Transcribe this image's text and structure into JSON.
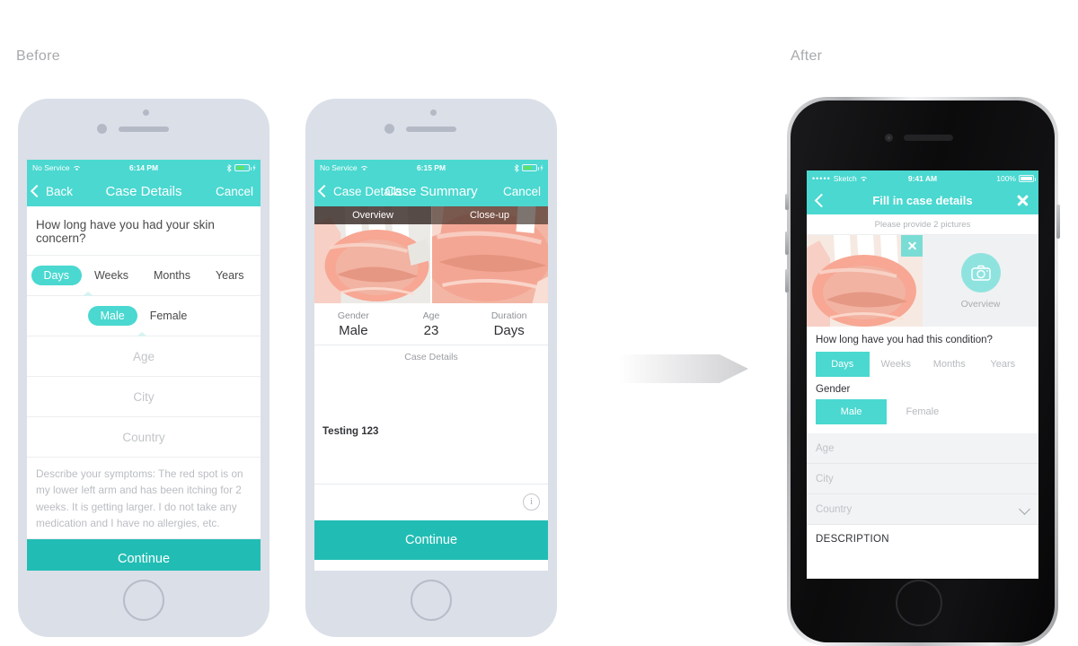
{
  "captions": {
    "before": "Before",
    "after": "After"
  },
  "arrow": {
    "name": "transition-arrow",
    "direction": "right",
    "color": "#d3d4d6"
  },
  "colors": {
    "teal_bar": "#4ad8d0",
    "teal_button": "#21bdb4",
    "teal_light": "#8fe3df",
    "phone_body_light": "#dbdfe8",
    "caption_gray": "#a7a9ac"
  },
  "phone1": {
    "status_bar": {
      "carrier": "No Service",
      "wifi_icon": "wifi-icon",
      "time": "6:14 PM",
      "bluetooth_icon": "bluetooth-icon",
      "battery_icon": "battery-icon",
      "charging_icon": "charging-bolt-icon"
    },
    "nav": {
      "back_icon": "chevron-left-icon",
      "back_label": "Back",
      "title": "Case Details",
      "cancel_label": "Cancel"
    },
    "question": "How long have you had your skin concern?",
    "duration_options": [
      "Days",
      "Weeks",
      "Months",
      "Years"
    ],
    "duration_selected": "Days",
    "gender_options": [
      "Male",
      "Female"
    ],
    "gender_selected": "Male",
    "fields": [
      {
        "name": "age-field",
        "placeholder": "Age",
        "value": ""
      },
      {
        "name": "city-field",
        "placeholder": "City",
        "value": ""
      },
      {
        "name": "country-field",
        "placeholder": "Country",
        "value": ""
      }
    ],
    "description_placeholder": "Describe your symptoms: The red spot is on my lower left arm and has been itching for 2 weeks. It is getting larger. I do not take any medication and I have no allergies, etc.",
    "continue_label": "Continue"
  },
  "phone2": {
    "status_bar": {
      "carrier": "No Service",
      "wifi_icon": "wifi-icon",
      "time": "6:15 PM",
      "bluetooth_icon": "bluetooth-icon",
      "battery_icon": "battery-icon",
      "charging_icon": "charging-bolt-icon"
    },
    "nav": {
      "back_icon": "chevron-left-icon",
      "back_label": "Case Details",
      "title": "Case Summary",
      "cancel_label": "Cancel"
    },
    "photo_tabs": [
      "Overview",
      "Close-up"
    ],
    "summary": [
      {
        "label": "Gender",
        "value": "Male"
      },
      {
        "label": "Age",
        "value": "23"
      },
      {
        "label": "Duration",
        "value": "Days"
      }
    ],
    "case_details_header": "Case Details",
    "case_details_text": "Testing 123",
    "info_icon": "info-circle-icon",
    "continue_label": "Continue"
  },
  "phone3": {
    "status_bar": {
      "signal_dots": "•••••",
      "carrier": "Sketch",
      "wifi_icon": "wifi-icon",
      "time": "9:41 AM",
      "battery_percent": "100%",
      "battery_icon": "battery-icon"
    },
    "nav": {
      "back_icon": "chevron-left-icon",
      "title": "Fill in case details",
      "close_icon": "close-x-icon"
    },
    "pictures_hint": "Please provide 2 pictures",
    "photo_remove_icon": "close-x-icon",
    "camera_slot": {
      "icon": "camera-icon",
      "label": "Overview"
    },
    "question": "How long have you had this condition?",
    "duration_options": [
      "Days",
      "Weeks",
      "Months",
      "Years"
    ],
    "duration_selected": "Days",
    "gender_label": "Gender",
    "gender_options": [
      "Male",
      "Female"
    ],
    "gender_selected": "Male",
    "fields": [
      {
        "name": "age-field",
        "placeholder": "Age",
        "value": ""
      },
      {
        "name": "city-field",
        "placeholder": "City",
        "value": ""
      },
      {
        "name": "country-field",
        "placeholder": "Country",
        "value": "",
        "chevron": "chevron-down-icon"
      }
    ],
    "description_label": "DESCRIPTION"
  }
}
